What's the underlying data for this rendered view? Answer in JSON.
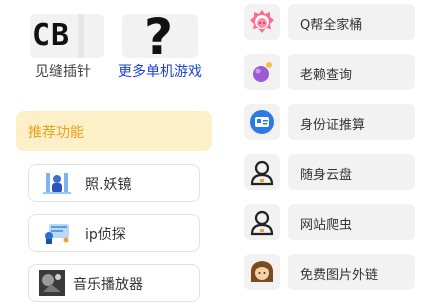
{
  "tiles": [
    {
      "label": "见缝插针",
      "glyph": "CB",
      "icon": "cb-logo-icon"
    },
    {
      "label": "更多单机游戏",
      "glyph": "?",
      "icon": "question-mark-icon"
    }
  ],
  "recommend": {
    "title": "推荐功能",
    "items": [
      {
        "label": "照.妖镜",
        "icon": "mirror-scan-icon"
      },
      {
        "label": "ip侦探",
        "icon": "ip-detective-icon"
      },
      {
        "label": "音乐播放器",
        "icon": "music-player-icon"
      }
    ]
  },
  "right_list": [
    {
      "label": "Q帮全家桶",
      "icon": "pink-pig-icon"
    },
    {
      "label": "老赖查询",
      "icon": "purple-bubble-icon"
    },
    {
      "label": "身份证推算",
      "icon": "id-card-icon"
    },
    {
      "label": "随身云盘",
      "icon": "user-outline-icon"
    },
    {
      "label": "网站爬虫",
      "icon": "user-outline-icon"
    },
    {
      "label": "免费图片外链",
      "icon": "girl-avatar-icon"
    }
  ],
  "colors": {
    "accent_blue": "#1a3fd6",
    "recommend_bg": "#fdf0c8",
    "recommend_text": "#e8a21a",
    "tile_bg": "#f2f2f2"
  }
}
